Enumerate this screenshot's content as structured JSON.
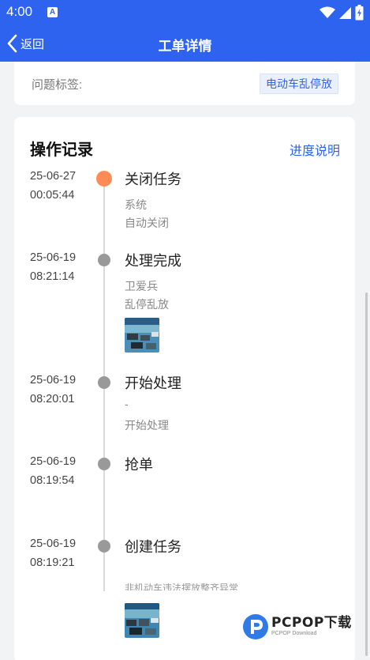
{
  "status_bar": {
    "time": "4:00",
    "notification_glyph": "A",
    "icons": [
      "wifi-icon",
      "cell-signal-icon",
      "battery-charging-icon"
    ]
  },
  "nav": {
    "back_label": "返回",
    "title": "工单详情"
  },
  "issue": {
    "label": "问题标签:",
    "tag": "电动车乱停放"
  },
  "log": {
    "title": "操作记录",
    "link": "进度说明",
    "entries": [
      {
        "date": "25-06-27",
        "time": "00:05:44",
        "action": "关闭任务",
        "user": "系统",
        "note": "自动关闭",
        "active": true,
        "has_photo": false
      },
      {
        "date": "25-06-19",
        "time": "08:21:14",
        "action": "处理完成",
        "user": "卫爱兵",
        "note": "乱停乱放",
        "active": false,
        "has_photo": true
      },
      {
        "date": "25-06-19",
        "time": "08:20:01",
        "action": "开始处理",
        "user": "-",
        "note": "开始处理",
        "active": false,
        "has_photo": false
      },
      {
        "date": "25-06-19",
        "time": "08:19:54",
        "action": "抢单",
        "user": "",
        "note": "",
        "active": false,
        "has_photo": false
      },
      {
        "date": "25-06-19",
        "time": "08:19:21",
        "action": "创建任务",
        "user": "",
        "note": "非机动车违法摆放整齐异常",
        "active": false,
        "has_photo": true
      }
    ]
  },
  "colors": {
    "brand": "#2e63f0",
    "active_dot": "#ff8c57",
    "dot": "#999999"
  },
  "watermark": {
    "main": "PCPOP下载",
    "sub": "PCPOP Download"
  }
}
